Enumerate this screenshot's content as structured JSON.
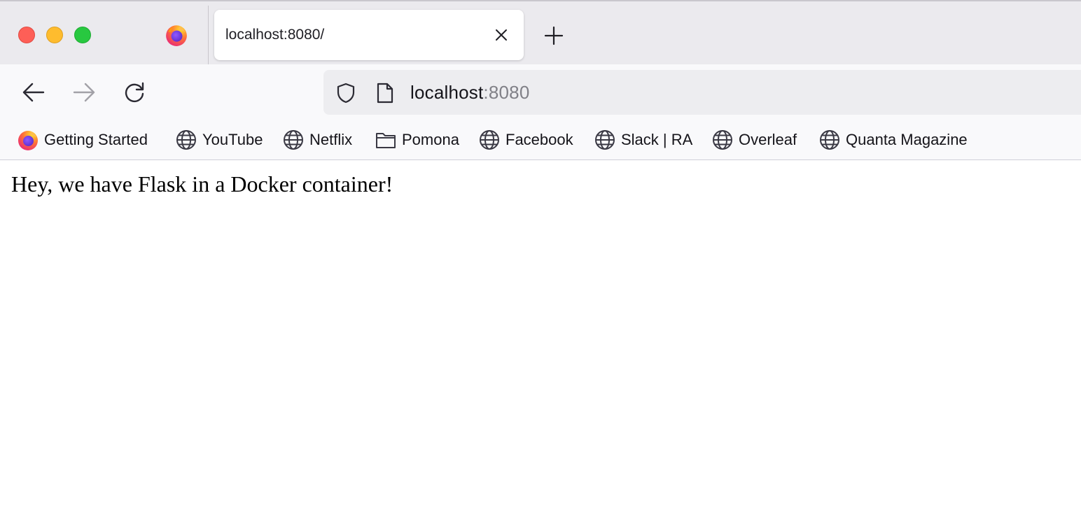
{
  "window": {
    "controls": [
      "close",
      "minimize",
      "zoom"
    ]
  },
  "tab": {
    "title": "localhost:8080/"
  },
  "address_bar": {
    "host": "localhost",
    "port": ":8080"
  },
  "bookmarks": [
    {
      "label": "Getting Started",
      "icon": "firefox-logo-icon"
    },
    {
      "label": "YouTube",
      "icon": "globe-icon"
    },
    {
      "label": "Netflix",
      "icon": "globe-icon"
    },
    {
      "label": "Pomona",
      "icon": "folder-icon"
    },
    {
      "label": "Facebook",
      "icon": "globe-icon"
    },
    {
      "label": "Slack | RA",
      "icon": "globe-icon"
    },
    {
      "label": "Overleaf",
      "icon": "globe-icon"
    },
    {
      "label": "Quanta Magazine",
      "icon": "globe-icon"
    }
  ],
  "page": {
    "text": "Hey, we have Flask in a Docker container!"
  },
  "colors": {
    "close": "#fe5f57",
    "minimize": "#febc2e",
    "zoom": "#28c840",
    "port_text": "#808087"
  }
}
